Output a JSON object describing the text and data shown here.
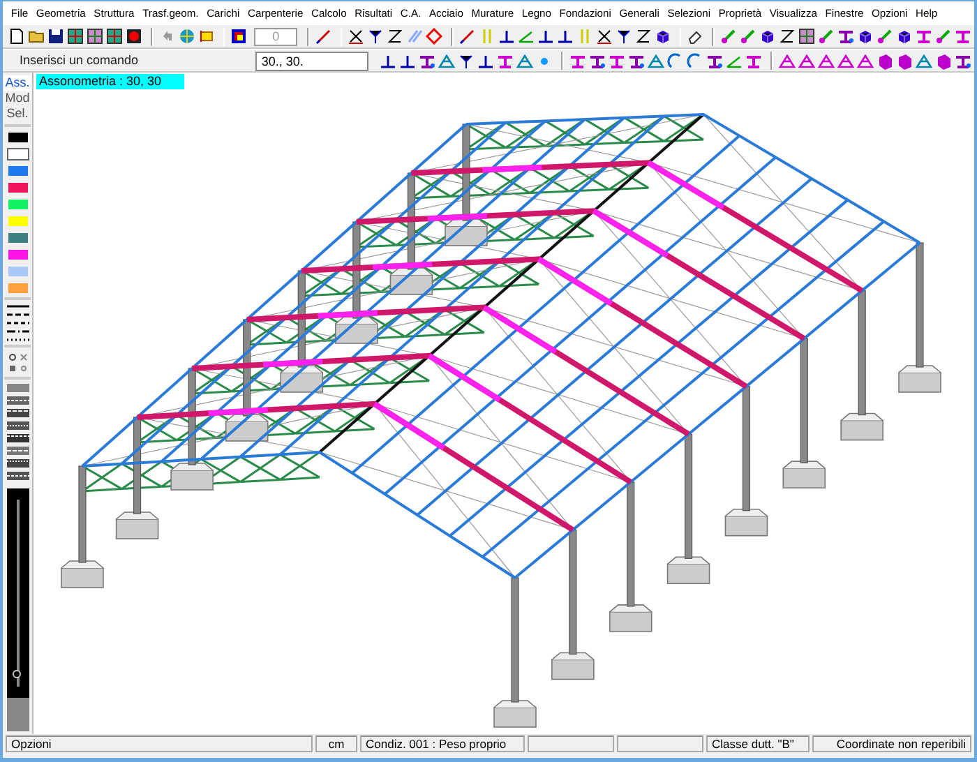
{
  "menu": [
    "File",
    "Geometria",
    "Struttura",
    "Trasf.geom.",
    "Carichi",
    "Carpenterie",
    "Calcolo",
    "Risultati",
    "C.A.",
    "Acciaio",
    "Murature",
    "Legno",
    "Fondazioni",
    "Generali",
    "Selezioni",
    "Proprietà",
    "Visualizza",
    "Finestre",
    "Opzioni",
    "Help"
  ],
  "toolbar": {
    "spin_value": "0",
    "spin_disabled": true
  },
  "command": {
    "prompt": "Inserisci un comando",
    "value": "30., 30."
  },
  "palette": {
    "modes": [
      {
        "label": "Ass.",
        "selected": true
      },
      {
        "label": "Mod",
        "selected": false
      },
      {
        "label": "Sel.",
        "selected": false
      }
    ],
    "colors": [
      {
        "color": "#000000",
        "selected": false
      },
      {
        "color": "#ffffff",
        "selected": true
      },
      {
        "color": "#1e7cf0",
        "selected": false
      },
      {
        "color": "#f0145a",
        "selected": false
      },
      {
        "color": "#14f064",
        "selected": false
      },
      {
        "color": "#ffff00",
        "selected": false
      },
      {
        "color": "#3c8282",
        "selected": false
      },
      {
        "color": "#ff14e6",
        "selected": false
      },
      {
        "color": "#aac8f5",
        "selected": false
      },
      {
        "color": "#ffa03c",
        "selected": false
      }
    ],
    "slider": {
      "level": 0.05
    }
  },
  "viewport": {
    "label": "Assonometria : 30, 30"
  },
  "status_bar": [
    "Opzioni",
    "cm",
    "Condiz. 001 : Peso proprio",
    "Classe dutt. \"B\"",
    "Coordinate non reperibili"
  ]
}
